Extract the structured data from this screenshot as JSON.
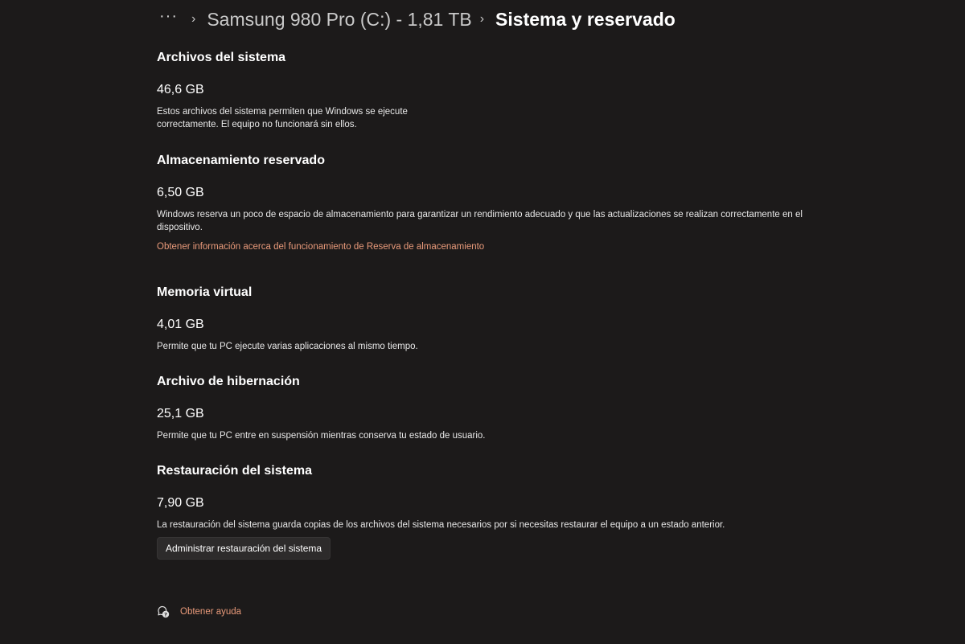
{
  "breadcrumb": {
    "more": "···",
    "separator": "›",
    "parent": "Samsung 980 Pro (C:) - 1,81 TB",
    "current": "Sistema y reservado"
  },
  "sections": [
    {
      "title": "Archivos del sistema",
      "size": "46,6 GB",
      "description_lines": [
        "Estos archivos del sistema permiten que Windows se ejecute",
        "correctamente. El equipo no funcionará sin ellos."
      ]
    },
    {
      "title": "Almacenamiento reservado",
      "size": "6,50 GB",
      "description_lines": [
        "Windows reserva un poco de espacio de almacenamiento para garantizar un rendimiento adecuado y que las actualizaciones se realizan correctamente en el",
        "dispositivo."
      ],
      "link": "Obtener información acerca del funcionamiento de Reserva de almacenamiento"
    },
    {
      "title": "Memoria virtual",
      "size": "4,01 GB",
      "description_lines": [
        "Permite que tu PC ejecute varias aplicaciones al mismo tiempo."
      ]
    },
    {
      "title": "Archivo de hibernación",
      "size": "25,1 GB",
      "description_lines": [
        "Permite que tu PC entre en suspensión mientras conserva tu estado de usuario."
      ]
    },
    {
      "title": "Restauración del sistema",
      "size": "7,90 GB",
      "description_lines": [
        "La restauración del sistema guarda copias de los archivos del sistema necesarios por si necesitas restaurar el equipo a un estado anterior."
      ],
      "button": "Administrar restauración del sistema"
    }
  ],
  "help": {
    "icon": "help-chat-icon",
    "label": "Obtener ayuda"
  },
  "colors": {
    "background": "#1c1a1a",
    "accent_link": "#e99a7a",
    "button_bg": "#2d2b2b"
  }
}
